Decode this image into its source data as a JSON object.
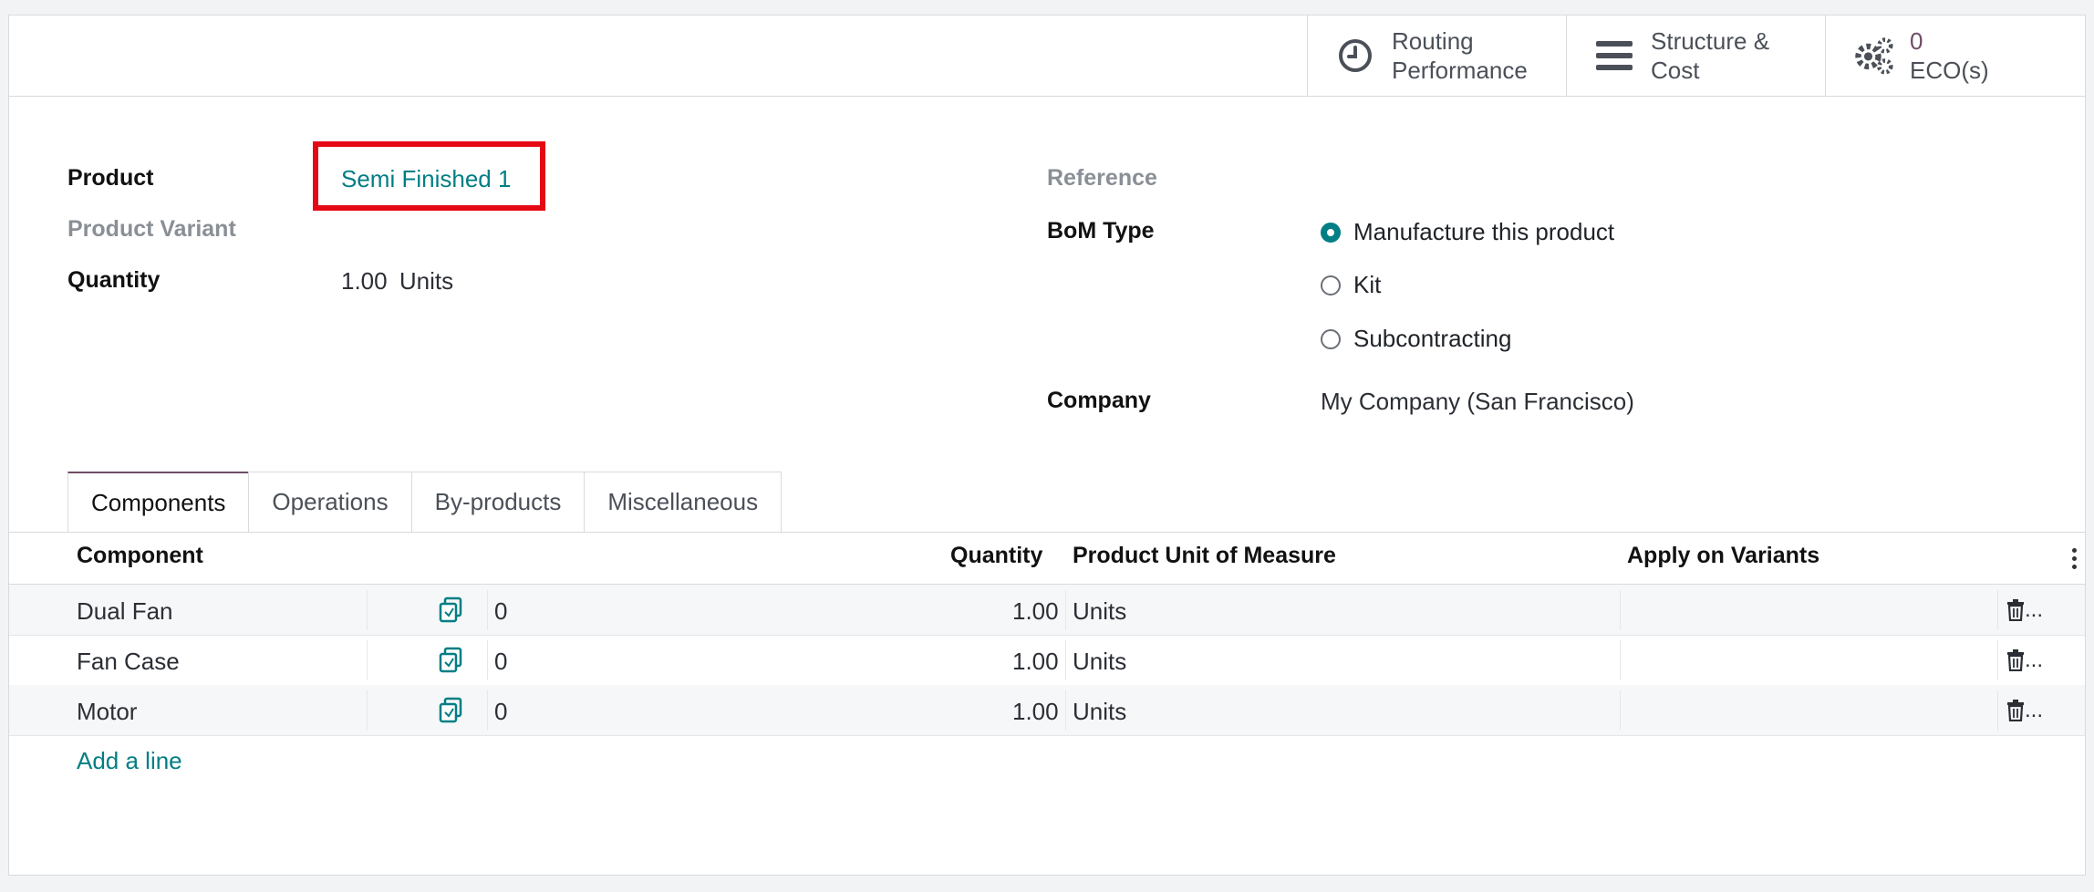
{
  "stat_buttons": {
    "routing": {
      "line1": "Routing",
      "line2": "Performance"
    },
    "structure": {
      "line1": "Structure &",
      "line2": "Cost"
    },
    "eco": {
      "count": "0",
      "label": "ECO(s)"
    }
  },
  "form": {
    "product_label": "Product",
    "product_value": "Semi Finished 1",
    "variant_label": "Product Variant",
    "quantity_label": "Quantity",
    "quantity_value": "1.00",
    "quantity_uom": "Units",
    "reference_label": "Reference",
    "bom_type_label": "BoM Type",
    "bom_types": [
      "Manufacture this product",
      "Kit",
      "Subcontracting"
    ],
    "bom_type_selected": "Manufacture this product",
    "company_label": "Company",
    "company_value": "My Company (San Francisco)"
  },
  "tabs": [
    "Components",
    "Operations",
    "By-products",
    "Miscellaneous"
  ],
  "active_tab": "Components",
  "table": {
    "headers": {
      "component": "Component",
      "quantity": "Quantity",
      "uom": "Product Unit of Measure",
      "variants": "Apply on Variants"
    },
    "rows": [
      {
        "component": "Dual Fan",
        "count": "0",
        "quantity": "1.00",
        "uom": "Units",
        "variants": ""
      },
      {
        "component": "Fan Case",
        "count": "0",
        "quantity": "1.00",
        "uom": "Units",
        "variants": ""
      },
      {
        "component": "Motor",
        "count": "0",
        "quantity": "1.00",
        "uom": "Units",
        "variants": ""
      }
    ],
    "trash_suffix": "...",
    "add_line": "Add a line"
  },
  "colors": {
    "accent": "#017e84",
    "brand": "#714b67",
    "highlight": "#e50914"
  },
  "icons": [
    "clock-icon",
    "bars-icon",
    "gears-icon",
    "copy-icon",
    "trash-icon",
    "kebab-icon"
  ]
}
